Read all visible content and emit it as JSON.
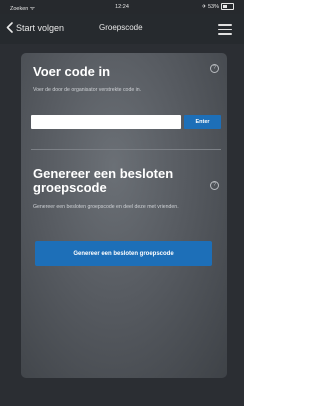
{
  "status_bar": {
    "carrier": "Zoeken ᯤ",
    "time": "12:24",
    "battery": "✈ 53%"
  },
  "nav": {
    "back_label": "Start volgen",
    "title": "Groepscode",
    "back_icon": "chevron-left-icon",
    "menu_icon": "hamburger-menu-icon"
  },
  "join": {
    "heading": "Voer code in",
    "description": "Voer de door de organisator verstrekte code in.",
    "input_value": "",
    "input_placeholder": "",
    "enter_label": "Enter"
  },
  "generate": {
    "heading": "Genereer een besloten groepscode",
    "description": "Genereer een besloten groepscode en deel deze met vrienden.",
    "button_label": "Genereer een besloten groepscode"
  },
  "colors": {
    "accent": "#1d6fb8",
    "background": "#2b2e33"
  }
}
